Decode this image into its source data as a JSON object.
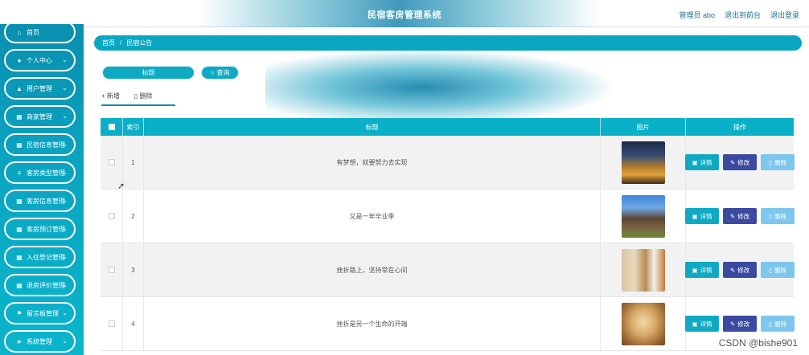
{
  "header": {
    "title": "民宿客房管理系统",
    "admin_label": "管理员 abo",
    "back_label": "退出到前台",
    "logout_label": "退出登录"
  },
  "sidebar": {
    "items": [
      {
        "label": "首页",
        "icon": "home-icon"
      },
      {
        "label": "个人中心",
        "icon": "user-icon"
      },
      {
        "label": "用户管理",
        "icon": "thumb-icon"
      },
      {
        "label": "商家管理",
        "icon": "grid-icon"
      },
      {
        "label": "民宿信息管理",
        "icon": "grid-icon"
      },
      {
        "label": "客房类型管理",
        "icon": "list-icon"
      },
      {
        "label": "客房信息管理",
        "icon": "grid-icon"
      },
      {
        "label": "客房预订管理",
        "icon": "grid-icon"
      },
      {
        "label": "入住登记管理",
        "icon": "grid-icon"
      },
      {
        "label": "退房评价管理",
        "icon": "grid-icon"
      },
      {
        "label": "留言板管理",
        "icon": "flag-icon"
      },
      {
        "label": "系统管理",
        "icon": "send-icon"
      }
    ]
  },
  "breadcrumb": {
    "home": "首页",
    "sep": "/",
    "current": "民宿公告"
  },
  "search": {
    "placeholder": "标题",
    "button": "查询"
  },
  "tabs": {
    "add": "新增",
    "delete": "删除"
  },
  "table": {
    "columns": [
      "索引",
      "标题",
      "图片",
      "操作"
    ],
    "rows": [
      {
        "index": "1",
        "title": "有梦想，就要努力去实现"
      },
      {
        "index": "2",
        "title": "又是一年毕业季"
      },
      {
        "index": "3",
        "title": "挫折路上，坚持常在心间"
      },
      {
        "index": "4",
        "title": "挫折是另一个生命的开端"
      }
    ],
    "actions": {
      "detail": "详情",
      "edit": "修改",
      "delete": "删除"
    }
  },
  "watermark": "CSDN @bishe901",
  "colors": {
    "accent": "#0aa6c2",
    "edit": "#3b4aa0",
    "delete": "#7dc6ee"
  }
}
